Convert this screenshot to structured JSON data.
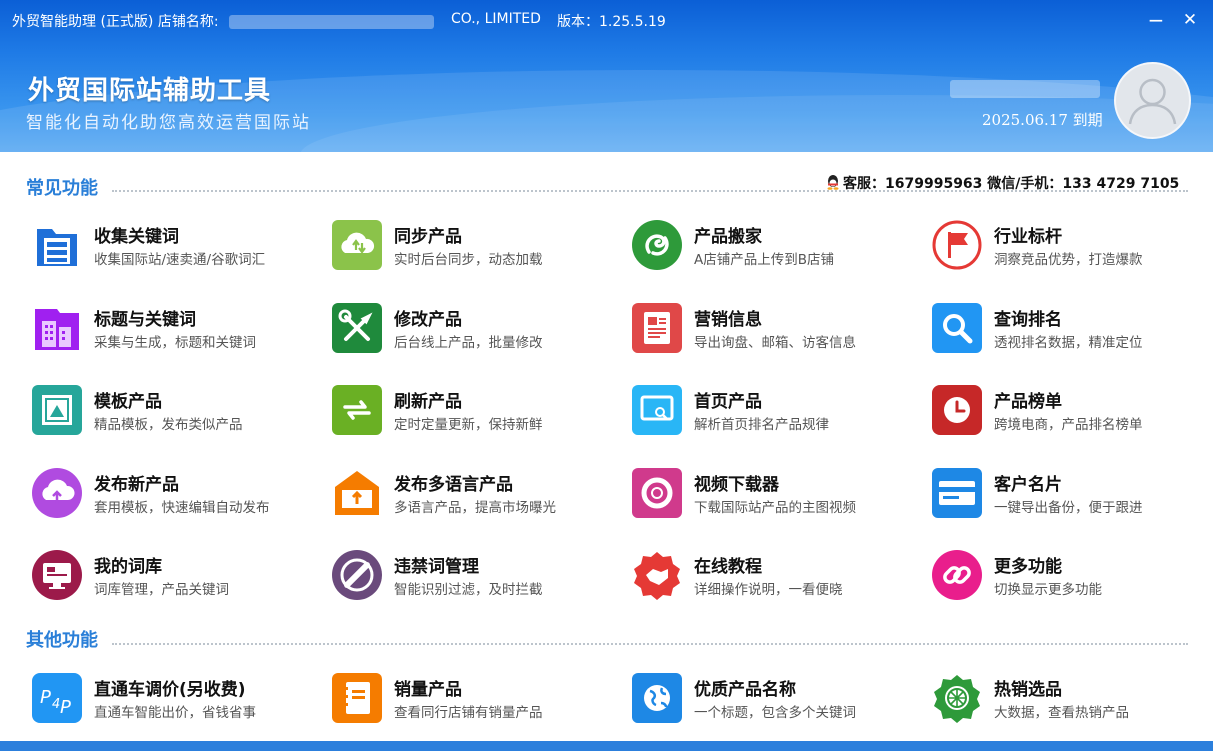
{
  "titlebar": {
    "text": "外贸智能助理 (正式版) 店铺名称:",
    "company": "CO., LIMITED",
    "version": "版本：1.25.5.19",
    "minimize": "−",
    "close": "✕"
  },
  "header": {
    "title": "外贸国际站辅助工具",
    "subtitle": "智能化自动化助您高效运营国际站",
    "expire": "2025.06.17 到期"
  },
  "common": {
    "title": "常见功能",
    "service": "客服：1679995963  微信/手机：133 4729 7105",
    "items": [
      {
        "name": "收集关键词",
        "desc": "收集国际站/速卖通/谷歌词汇",
        "icon": "folder-cabinet-icon",
        "color": "#1f6fd8"
      },
      {
        "name": "同步产品",
        "desc": "实时后台同步，动态加载",
        "icon": "cloud-sync-icon",
        "color": "#8bc34a"
      },
      {
        "name": "产品搬家",
        "desc": "A店铺产品上传到B店铺",
        "icon": "swirl-icon",
        "color": "#2e9a3a"
      },
      {
        "name": "行业标杆",
        "desc": "洞察竞品优势，打造爆款",
        "icon": "flag-icon",
        "color": "#e53935"
      },
      {
        "name": "标题与关键词",
        "desc": "采集与生成，标题和关键词",
        "icon": "building-icon",
        "color": "#a020f0"
      },
      {
        "name": "修改产品",
        "desc": "后台线上产品，批量修改",
        "icon": "tools-icon",
        "color": "#1f8a3c"
      },
      {
        "name": "营销信息",
        "desc": "导出询盘、邮箱、访客信息",
        "icon": "document-icon",
        "color": "#e04848"
      },
      {
        "name": "查询排名",
        "desc": "透视排名数据，精准定位",
        "icon": "search-icon",
        "color": "#2196f3"
      },
      {
        "name": "模板产品",
        "desc": "精品模板，发布类似产品",
        "icon": "template-icon",
        "color": "#26a69a"
      },
      {
        "name": "刷新产品",
        "desc": "定时定量更新，保持新鲜",
        "icon": "refresh-icon",
        "color": "#6ab024"
      },
      {
        "name": "首页产品",
        "desc": "解析首页排名产品规律",
        "icon": "monitor-search-icon",
        "color": "#29b6f6"
      },
      {
        "name": "产品榜单",
        "desc": "跨境电商，产品排名榜单",
        "icon": "clock-icon",
        "color": "#c62828"
      },
      {
        "name": "发布新产品",
        "desc": "套用模板，快速编辑自动发布",
        "icon": "cloud-upload-icon",
        "color": "#b04be0"
      },
      {
        "name": "发布多语言产品",
        "desc": "多语言产品，提高市场曝光",
        "icon": "inbox-upload-icon",
        "color": "#f57c00"
      },
      {
        "name": "视频下载器",
        "desc": "下载国际站产品的主图视频",
        "icon": "lifebuoy-icon",
        "color": "#d03a8c"
      },
      {
        "name": "客户名片",
        "desc": "一键导出备份，便于跟进",
        "icon": "card-icon",
        "color": "#1e88e5"
      },
      {
        "name": "我的词库",
        "desc": "词库管理，产品关键词",
        "icon": "computer-icon",
        "color": "#9c1a4a"
      },
      {
        "name": "违禁词管理",
        "desc": "智能识别过滤，及时拦截",
        "icon": "forbidden-icon",
        "color": "#6a4a7c"
      },
      {
        "name": "在线教程",
        "desc": "详细操作说明，一看便晓",
        "icon": "handshake-icon",
        "color": "#e53935"
      },
      {
        "name": "更多功能",
        "desc": "切换显示更多功能",
        "icon": "link-icon",
        "color": "#e91e8c"
      }
    ]
  },
  "other": {
    "title": "其他功能",
    "items": [
      {
        "name": "直通车调价(另收费)",
        "desc": "直通车智能出价，省钱省事",
        "icon": "p4p-icon",
        "color": "#2196f3"
      },
      {
        "name": "销量产品",
        "desc": "查看同行店铺有销量产品",
        "icon": "notebook-icon",
        "color": "#f57c00"
      },
      {
        "name": "优质产品名称",
        "desc": "一个标题，包含多个关键词",
        "icon": "globe-icon",
        "color": "#1e88e5"
      },
      {
        "name": "热销选品",
        "desc": "大数据，查看热销产品",
        "icon": "wheel-icon",
        "color": "#2e9a3a"
      }
    ]
  }
}
